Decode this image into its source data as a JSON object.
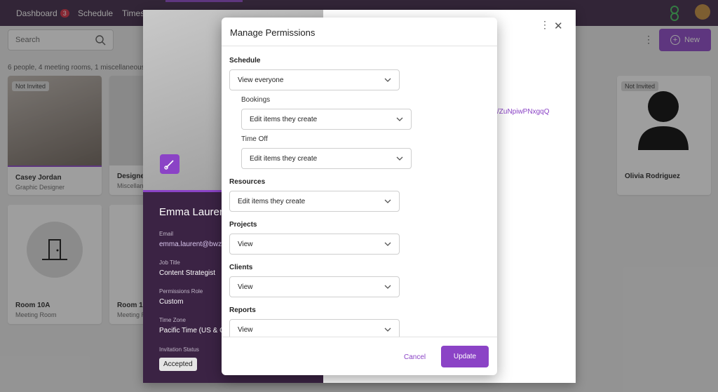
{
  "topbar": {
    "dashboard": "Dashboard",
    "badge": "3",
    "schedule": "Schedule",
    "timesheets": "Timesh"
  },
  "search": {
    "placeholder": "Search"
  },
  "new_label": "New",
  "summary": "6 people, 4 meeting rooms, 1 miscellaneous",
  "cards": [
    {
      "tag": "Not Invited",
      "name": "Casey Jordan",
      "sub": "Graphic Designer"
    },
    {
      "name": "Designe",
      "sub": "Miscellan"
    },
    {
      "tag": "Not Invited",
      "name": "Olivia Rodriguez",
      "sub": ""
    },
    {
      "name": "Room 10A",
      "sub": "Meeting Room"
    },
    {
      "name": "Room 10",
      "sub": "Meeting R"
    }
  ],
  "profile": {
    "name": "Emma Lauren",
    "email_label": "Email",
    "email": "emma.laurent@bwz.",
    "job_label": "Job Title",
    "job": "Content Strategist",
    "role_label": "Permissions Role",
    "role": "Custom",
    "tz_label": "Time Zone",
    "tz": "Pacific Time (US & C",
    "inv_label": "Invitation Status",
    "inv": "Accepted",
    "link": "s/ZuNpiwPNxgqQ"
  },
  "modal": {
    "title": "Manage Permissions",
    "schedule": "Schedule",
    "schedule_val": "View everyone",
    "bookings": "Bookings",
    "bookings_val": "Edit items they create",
    "timeoff": "Time Off",
    "timeoff_val": "Edit items they create",
    "resources": "Resources",
    "resources_val": "Edit items they create",
    "projects": "Projects",
    "projects_val": "View",
    "clients": "Clients",
    "clients_val": "View",
    "reports": "Reports",
    "reports_val": "View",
    "cancel": "Cancel",
    "update": "Update"
  },
  "colors": {
    "brand": "#8b43c6",
    "topbar": "#3b2344"
  }
}
